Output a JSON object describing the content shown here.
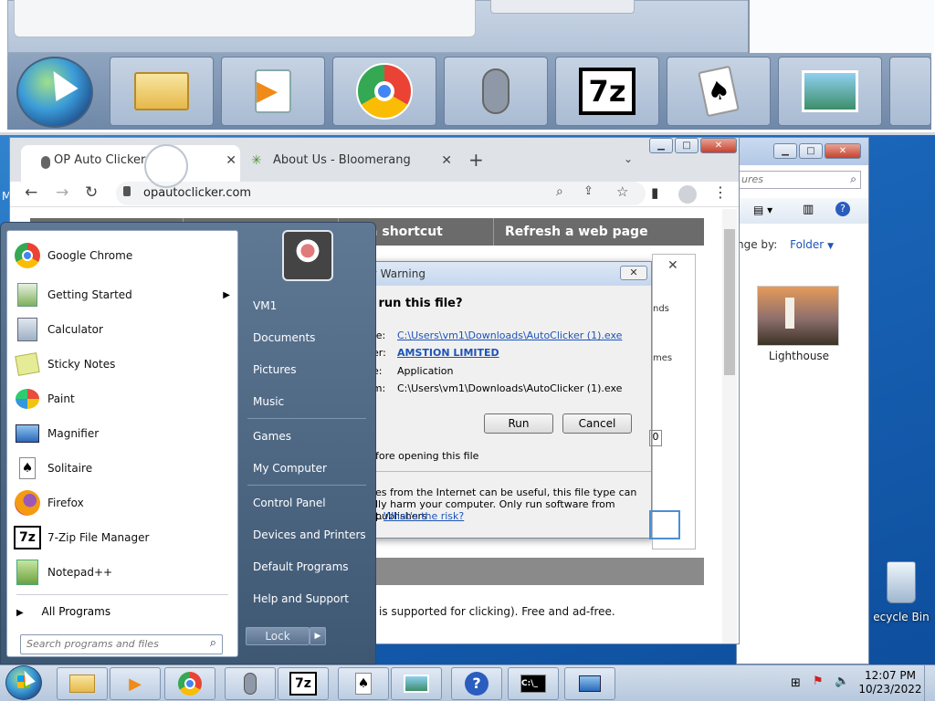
{
  "chrome": {
    "tabs": [
      {
        "label": "OP Auto Clicker"
      },
      {
        "label": "About Us - Bloomerang"
      }
    ],
    "url": "opautoclicker.com",
    "nav": [
      "et a shortcut",
      "Refresh a web page"
    ],
    "page_text": "is supported for clicking). Free and ad-free."
  },
  "dialog": {
    "title": "ty Warning",
    "question": "o run this file?",
    "rows": [
      {
        "label": "me:",
        "value": "C:\\Users\\vm1\\Downloads\\AutoClicker (1).exe"
      },
      {
        "label": "her:",
        "value": "AMSTION LIMITED"
      },
      {
        "label": "pe:",
        "value": "Application"
      },
      {
        "label": "om:",
        "value": "C:\\Users\\vm1\\Downloads\\AutoClicker (1).exe"
      }
    ],
    "run": "Run",
    "cancel": "Cancel",
    "checkbox": "fore opening this file",
    "warn1": "es from the Internet can be useful, this file type can",
    "warn2": "lly harm your computer. Only run software from publishers",
    "warn3": "t.",
    "risk_link": "What's the risk?",
    "side_nds": "nds",
    "side_mes": "mes",
    "side_field": "0"
  },
  "explorer": {
    "search_placeholder": "ures",
    "arrange": "nge by:",
    "folder": "Folder",
    "thumb_label": "Lighthouse"
  },
  "start_menu": {
    "programs": [
      {
        "label": "Google Chrome",
        "icon": "chrome-icon"
      },
      {
        "label": "Getting Started",
        "icon": "getting-started-icon"
      },
      {
        "label": "Calculator",
        "icon": "calculator-icon"
      },
      {
        "label": "Sticky Notes",
        "icon": "sticky-notes-icon"
      },
      {
        "label": "Paint",
        "icon": "paint-icon"
      },
      {
        "label": "Magnifier",
        "icon": "magnifier-icon"
      },
      {
        "label": "Solitaire",
        "icon": "solitaire-icon"
      },
      {
        "label": "Firefox",
        "icon": "firefox-icon"
      },
      {
        "label": "7-Zip File Manager",
        "icon": "7zip-icon"
      },
      {
        "label": "Notepad++",
        "icon": "notepadpp-icon"
      }
    ],
    "all_programs": "All Programs",
    "search_placeholder": "Search programs and files",
    "right_links": [
      "VM1",
      "Documents",
      "Pictures",
      "Music",
      "Games",
      "My Computer",
      "Control Panel",
      "Devices and Printers",
      "Default Programs",
      "Help and Support"
    ],
    "lock": "Lock"
  },
  "taskbar": {
    "time": "12:07 PM",
    "date": "10/23/2022"
  },
  "desktop": {
    "recycle_label": "ecycle Bin",
    "left_char": "M"
  },
  "zoom": {
    "seven_zip": "7z"
  }
}
